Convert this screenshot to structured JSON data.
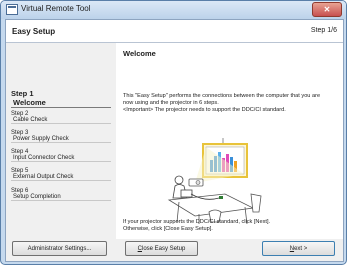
{
  "window": {
    "title": "Virtual Remote Tool",
    "close_glyph": "✕"
  },
  "header": {
    "title": "Easy Setup",
    "step_indicator": "Step  1/6"
  },
  "sidebar": {
    "items": [
      {
        "number": "Step 1",
        "name": "Welcome"
      },
      {
        "number": "Step 2",
        "name": "Cable Check"
      },
      {
        "number": "Step 3",
        "name": "Power Supply Check"
      },
      {
        "number": "Step 4",
        "name": "Input Connector Check"
      },
      {
        "number": "Step 5",
        "name": "External Output Check"
      },
      {
        "number": "Step 6",
        "name": "Setup Completion"
      }
    ]
  },
  "content": {
    "title": "Welcome",
    "intro_line1": "This \"Easy Setup\" performs the connections between the computer that you are",
    "intro_line2": "now using and the projector in 6 steps.",
    "intro_line3": "<Important> The projector needs to support the DDC/CI standard.",
    "footer_line1": "If your projector supports the DDC/CI standard, click [Next].",
    "footer_line2": "Otherwise, click [Close Easy Setup]."
  },
  "buttons": {
    "admin": "Administrator Settings...",
    "close_underline": "C",
    "close_rest": "lose Easy Setup",
    "next_underline": "N",
    "next_rest": "ext >"
  },
  "colors": {
    "window_frame": "#c5d9ee",
    "close_button": "#c75050",
    "screen_border": "#e8c33a"
  }
}
